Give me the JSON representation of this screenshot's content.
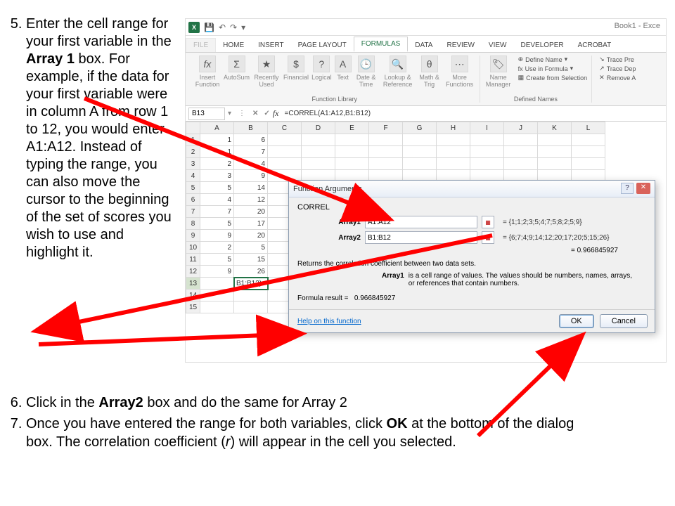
{
  "instructions": {
    "i5_pre": "Enter the cell range for your first variable in the ",
    "i5_b1": "Array 1",
    "i5_post": " box. For example, if the data for your first variable were in column A from row 1 to 12, you would enter A1:A12. Instead of typing the range, you can also move the cursor to the beginning of the set of scores you wish to use and highlight it.",
    "i6_pre": "Click in the ",
    "i6_b": "Array2",
    "i6_post": " box and do the same for Array 2",
    "i7_pre": "Once you have entered the range for both variables, click ",
    "i7_b": "OK",
    "i7_mid": " at the bottom of the dialog box. The correlation coefficient (",
    "i7_it": "r",
    "i7_post": ") will appear in the cell you selected."
  },
  "excel": {
    "qat": {
      "logo": "X",
      "title_right": "Book1 - Exce"
    },
    "tabs": [
      "FILE",
      "HOME",
      "INSERT",
      "PAGE LAYOUT",
      "FORMULAS",
      "DATA",
      "REVIEW",
      "VIEW",
      "DEVELOPER",
      "Acrobat"
    ],
    "ribbon": {
      "g1_label": "",
      "ins_fn": "Insert Function",
      "autosum": "AutoSum",
      "recent": "Recently Used",
      "financial": "Financial",
      "logical": "Logical",
      "text": "Text",
      "date": "Date & Time",
      "lookup": "Lookup & Reference",
      "math": "Math & Trig",
      "more": "More Functions",
      "lib_label": "Function Library",
      "name_mgr": "Name Manager",
      "def_name": "Define Name",
      "use_formula": "Use in Formula",
      "create_sel": "Create from Selection",
      "defnames_label": "Defined Names",
      "trace_pre": "Trace Pre",
      "trace_dep": "Trace Dep",
      "remove_a": "Remove A"
    },
    "fbar": {
      "namebox": "B13",
      "formula": "=CORREL(A1:A12,B1:B12)"
    },
    "cols": [
      "A",
      "B",
      "C",
      "D",
      "E",
      "F",
      "G",
      "H",
      "I",
      "J",
      "K",
      "L"
    ],
    "rows": [
      {
        "n": "1",
        "a": "1",
        "b": "6"
      },
      {
        "n": "2",
        "a": "1",
        "b": "7"
      },
      {
        "n": "3",
        "a": "2",
        "b": "4"
      },
      {
        "n": "4",
        "a": "3",
        "b": "9"
      },
      {
        "n": "5",
        "a": "5",
        "b": "14"
      },
      {
        "n": "6",
        "a": "4",
        "b": "12"
      },
      {
        "n": "7",
        "a": "7",
        "b": "20"
      },
      {
        "n": "8",
        "a": "5",
        "b": "17"
      },
      {
        "n": "9",
        "a": "9",
        "b": "20"
      },
      {
        "n": "10",
        "a": "2",
        "b": "5"
      },
      {
        "n": "11",
        "a": "5",
        "b": "15"
      },
      {
        "n": "12",
        "a": "9",
        "b": "26"
      },
      {
        "n": "13",
        "a": "",
        "b": "B1:B12)"
      },
      {
        "n": "14",
        "a": "",
        "b": ""
      },
      {
        "n": "15",
        "a": "",
        "b": ""
      }
    ]
  },
  "dialog": {
    "title": "Function Arguments",
    "func": "CORREL",
    "array1_label": "Array1",
    "array1_value": "A1:A12",
    "array1_result": "=  {1;1;2;3;5;4;7;5;8;2;5;9}",
    "array2_label": "Array2",
    "array2_value": "B1:B12",
    "array2_result": "=  {6;7;4;9;14;12;20;17;20;5;15;26}",
    "calc_result": "=  0.966845927",
    "desc": "Returns the correlation coefficient between two data sets.",
    "arg_name": "Array1",
    "arg_desc": "is a cell range of values. The values should be numbers, names, arrays, or references that contain numbers.",
    "formula_result_label": "Formula result =",
    "formula_result": "0.966845927",
    "help_link": "Help on this function",
    "ok": "OK",
    "cancel": "Cancel"
  }
}
